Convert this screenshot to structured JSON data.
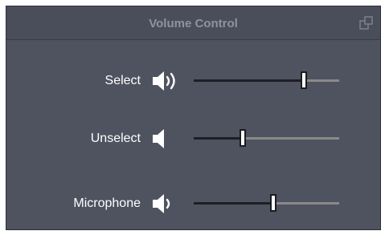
{
  "window": {
    "title": "Volume Control",
    "popout_icon": "popout-icon"
  },
  "rows": [
    {
      "label": "Select",
      "icon": "speaker-loud-icon",
      "level": 0.76
    },
    {
      "label": "Unselect",
      "icon": "speaker-mute-icon",
      "level": 0.34
    },
    {
      "label": "Microphone",
      "icon": "speaker-medium-icon",
      "level": 0.55
    }
  ],
  "colors": {
    "panel": "#4f5360",
    "slider_fill": "#1d1f25",
    "slider_track": "#8a8a8a"
  }
}
